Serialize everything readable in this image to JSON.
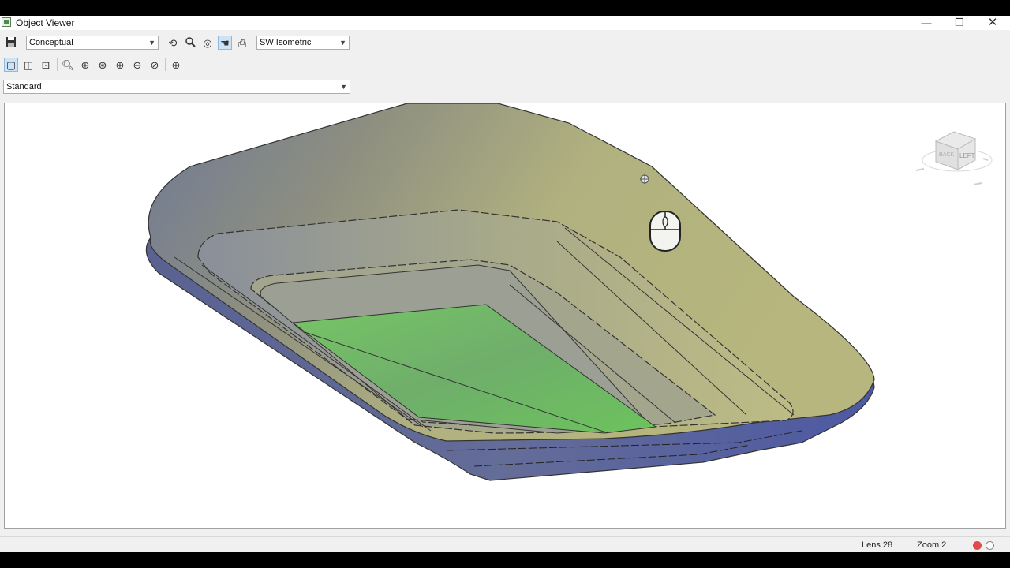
{
  "window": {
    "title": "Object Viewer",
    "controls": {
      "minimize": "—",
      "restore": "❐",
      "close": "✕"
    }
  },
  "toolbar": {
    "visual_style": "Conceptual",
    "view_preset": "SW Isometric",
    "ucs": "Standard"
  },
  "viewcube": {
    "face_label": "LEFT",
    "side_label": "BACK"
  },
  "statusbar": {
    "lens": "Lens 28",
    "zoom": "Zoom 2"
  },
  "colors": {
    "body_top": "#b3b481",
    "body_side": "#58619b",
    "floor": "#6fbf5e",
    "active_tool": "#cfe3f7",
    "status_red": "#e04a4a"
  }
}
